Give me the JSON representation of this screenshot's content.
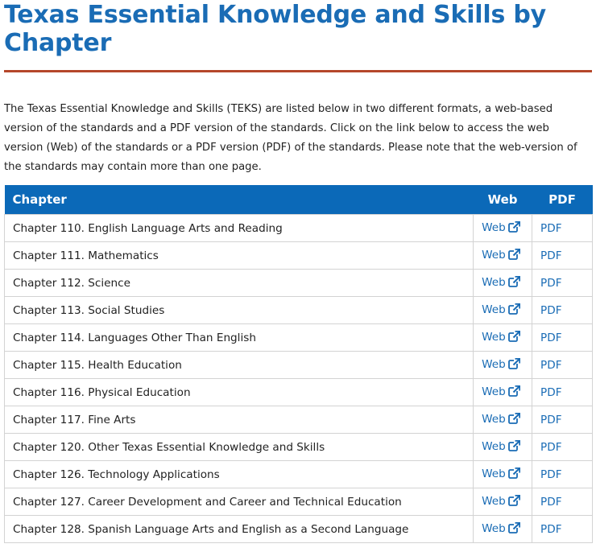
{
  "header": {
    "title": "Texas Essential Knowledge and Skills by Chapter"
  },
  "intro": "The Texas Essential Knowledge and Skills (TEKS) are listed below in two different formats, a web-based version of the standards and a PDF version of the standards. Click on the link below to access the web version (Web) of the standards or a PDF version (PDF) of the standards. Please note that the web-version of the standards may contain more than one page.",
  "table": {
    "headers": {
      "chapter": "Chapter",
      "web": "Web",
      "pdf": "PDF"
    },
    "rows": [
      {
        "chapter": "Chapter 110. English Language Arts and Reading",
        "web": "Web",
        "pdf": "PDF"
      },
      {
        "chapter": "Chapter 111. Mathematics",
        "web": "Web",
        "pdf": "PDF"
      },
      {
        "chapter": "Chapter 112. Science",
        "web": "Web",
        "pdf": "PDF"
      },
      {
        "chapter": "Chapter 113. Social Studies",
        "web": "Web",
        "pdf": "PDF"
      },
      {
        "chapter": "Chapter 114. Languages Other Than English",
        "web": "Web",
        "pdf": "PDF"
      },
      {
        "chapter": "Chapter 115. Health Education",
        "web": "Web",
        "pdf": "PDF"
      },
      {
        "chapter": "Chapter 116. Physical Education",
        "web": "Web",
        "pdf": "PDF"
      },
      {
        "chapter": "Chapter 117. Fine Arts",
        "web": "Web",
        "pdf": "PDF"
      },
      {
        "chapter": "Chapter 120. Other Texas Essential Knowledge and Skills",
        "web": "Web",
        "pdf": "PDF"
      },
      {
        "chapter": "Chapter 126. Technology Applications",
        "web": "Web",
        "pdf": "PDF"
      },
      {
        "chapter": "Chapter 127. Career Development and Career and Technical Education",
        "web": "Web",
        "pdf": "PDF"
      },
      {
        "chapter": "Chapter 128. Spanish Language Arts and English as a Second Language",
        "web": "Web",
        "pdf": "PDF"
      }
    ],
    "web_link_icon": "external-link-icon"
  },
  "colors": {
    "title": "#1a6cb5",
    "rule": "#b5472a",
    "header_bg": "#0b69b8",
    "link": "#1a6cb5"
  }
}
